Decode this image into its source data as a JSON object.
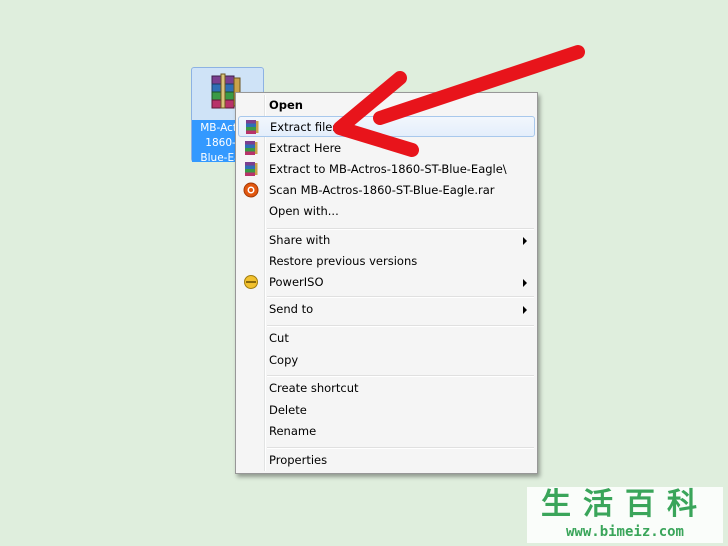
{
  "desktop": {
    "file_label": "MB-Actros-1860-ST-Blue-Eagle"
  },
  "context_menu": {
    "items": [
      {
        "label": "Open",
        "bold": true
      },
      {
        "label": "Extract files...",
        "icon": "winrar-icon",
        "highlighted": true
      },
      {
        "label": "Extract Here",
        "icon": "winrar-icon"
      },
      {
        "label": "Extract to MB-Actros-1860-ST-Blue-Eagle\\",
        "icon": "winrar-icon"
      },
      {
        "label": "Scan MB-Actros-1860-ST-Blue-Eagle.rar",
        "icon": "antivirus-icon"
      },
      {
        "label": "Open with..."
      },
      {
        "label": "Share with",
        "submenu": true
      },
      {
        "label": "Restore previous versions"
      },
      {
        "label": "PowerISO",
        "icon": "poweriso-icon",
        "submenu": true
      },
      {
        "label": "Send to",
        "submenu": true
      },
      {
        "label": "Cut"
      },
      {
        "label": "Copy"
      },
      {
        "label": "Create shortcut"
      },
      {
        "label": "Delete"
      },
      {
        "label": "Rename"
      },
      {
        "label": "Properties"
      }
    ]
  },
  "watermark": {
    "chinese": "生活百科",
    "url": "www.bimeiz.com"
  },
  "colors": {
    "desktop_bg": "#dfeedd",
    "arrow": "#e8141b",
    "watermark": "#3aa55a"
  }
}
